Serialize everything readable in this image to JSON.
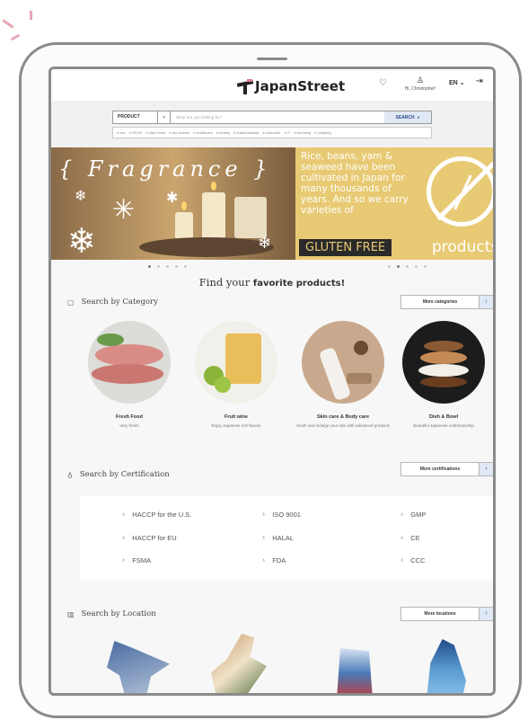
{
  "header": {
    "logo_text": "JapanStreet",
    "user_greeting": "Hi, Christopher!",
    "language": "EN"
  },
  "search": {
    "category_select": "PRODUCT",
    "placeholder": "What are you looking for?",
    "button_label": "SEARCH",
    "tags": [
      "# eco",
      "# SDGS",
      "# stay home",
      "# pet clothes",
      "# healthcare",
      "# elderly",
      "# craftsmanship",
      "# character",
      "# IT",
      "# licensing",
      "# camping"
    ]
  },
  "banners": {
    "left_title": "{ Fragrance }",
    "right_text": "Rice, beans, yam & seaweed have been cultivated in Japan for many thousands of years. And so we carry varieties of",
    "right_label": "GLUTEN FREE",
    "right_products": "products"
  },
  "find": {
    "prefix": "Find your",
    "highlight": "favorite products!"
  },
  "category_section": {
    "title": "Search by Category",
    "more_label": "More categories",
    "items": [
      {
        "name": "Fresh Food",
        "desc": "Very fresh!"
      },
      {
        "name": "Fruit wine",
        "desc": "Enjoy Japanese rich flavors"
      },
      {
        "name": "Skin care & Body care",
        "desc": "Sooth and indulge your skin with advanced products"
      },
      {
        "name": "Dish & Bowl",
        "desc": "Beautiful Japanese craftsmanship"
      }
    ]
  },
  "certification_section": {
    "title": "Search by Certification",
    "more_label": "More certifications",
    "items": [
      "HACCP for the U.S.",
      "ISO 9001",
      "GMP",
      "HACCP for EU",
      "HALAL",
      "CE",
      "FSMA",
      "FDA",
      "CCC"
    ]
  },
  "location_section": {
    "title": "Search by Location",
    "more_label": "More locations"
  },
  "colors": {
    "accent": "#2c4a8c",
    "button_arrow_bg": "#dfe8f4",
    "banner_yellow": "#e8ca74",
    "frame": "#8a8a8a"
  },
  "icons": {
    "heart": "heart-icon",
    "user": "user-icon",
    "logout": "logout-icon",
    "search": "search-icon",
    "category": "grid-icon",
    "certification": "badge-icon",
    "location": "map-icon"
  }
}
